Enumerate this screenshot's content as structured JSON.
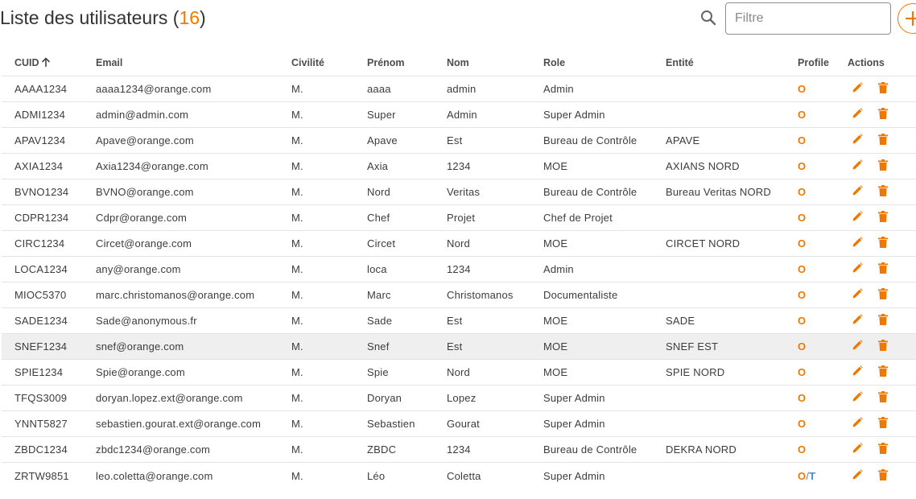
{
  "header": {
    "title": "Liste des utilisateurs",
    "count_open": "(",
    "count": "16",
    "count_close": ")",
    "filter_placeholder": "Filtre",
    "filter_value": ""
  },
  "table": {
    "columns": [
      "CUID",
      "Email",
      "Civilité",
      "Prénom",
      "Nom",
      "Role",
      "Entité",
      "Profile",
      "Actions"
    ],
    "sorted_column": "CUID",
    "sort_direction": "ascending",
    "rows": [
      {
        "cuid": "AAAA1234",
        "email": "aaaa1234@orange.com",
        "civilite": "M.",
        "prenom": "aaaa",
        "nom": "admin",
        "role": "Admin",
        "entite": "",
        "profile": [
          "O"
        ]
      },
      {
        "cuid": "ADMI1234",
        "email": "admin@admin.com",
        "civilite": "M.",
        "prenom": "Super",
        "nom": "Admin",
        "role": "Super Admin",
        "entite": "",
        "profile": [
          "O"
        ]
      },
      {
        "cuid": "APAV1234",
        "email": "Apave@orange.com",
        "civilite": "M.",
        "prenom": "Apave",
        "nom": "Est",
        "role": "Bureau de Contrôle",
        "entite": "APAVE",
        "profile": [
          "O"
        ]
      },
      {
        "cuid": "AXIA1234",
        "email": "Axia1234@orange.com",
        "civilite": "M.",
        "prenom": "Axia",
        "nom": "1234",
        "role": "MOE",
        "entite": "AXIANS NORD",
        "profile": [
          "O"
        ]
      },
      {
        "cuid": "BVNO1234",
        "email": "BVNO@orange.com",
        "civilite": "M.",
        "prenom": "Nord",
        "nom": "Veritas",
        "role": "Bureau de Contrôle",
        "entite": "Bureau Veritas NORD",
        "profile": [
          "O"
        ]
      },
      {
        "cuid": "CDPR1234",
        "email": "Cdpr@orange.com",
        "civilite": "M.",
        "prenom": "Chef",
        "nom": "Projet",
        "role": "Chef de Projet",
        "entite": "",
        "profile": [
          "O"
        ]
      },
      {
        "cuid": "CIRC1234",
        "email": "Circet@orange.com",
        "civilite": "M.",
        "prenom": "Circet",
        "nom": "Nord",
        "role": "MOE",
        "entite": "CIRCET NORD",
        "profile": [
          "O"
        ]
      },
      {
        "cuid": "LOCA1234",
        "email": "any@orange.com",
        "civilite": "M.",
        "prenom": "loca",
        "nom": "1234",
        "role": "Admin",
        "entite": "",
        "profile": [
          "O"
        ]
      },
      {
        "cuid": "MIOC5370",
        "email": "marc.christomanos@orange.com",
        "civilite": "M.",
        "prenom": "Marc",
        "nom": "Christomanos",
        "role": "Documentaliste",
        "entite": "",
        "profile": [
          "O"
        ]
      },
      {
        "cuid": "SADE1234",
        "email": "Sade@anonymous.fr",
        "civilite": "M.",
        "prenom": "Sade",
        "nom": "Est",
        "role": "MOE",
        "entite": "SADE",
        "profile": [
          "O"
        ]
      },
      {
        "cuid": "SNEF1234",
        "email": "snef@orange.com",
        "civilite": "M.",
        "prenom": "Snef",
        "nom": "Est",
        "role": "MOE",
        "entite": "SNEF EST",
        "profile": [
          "O"
        ],
        "highlighted": true
      },
      {
        "cuid": "SPIE1234",
        "email": "Spie@orange.com",
        "civilite": "M.",
        "prenom": "Spie",
        "nom": "Nord",
        "role": "MOE",
        "entite": "SPIE NORD",
        "profile": [
          "O"
        ]
      },
      {
        "cuid": "TFQS3009",
        "email": "doryan.lopez.ext@orange.com",
        "civilite": "M.",
        "prenom": "Doryan",
        "nom": "Lopez",
        "role": "Super Admin",
        "entite": "",
        "profile": [
          "O"
        ]
      },
      {
        "cuid": "YNNT5827",
        "email": "sebastien.gourat.ext@orange.com",
        "civilite": "M.",
        "prenom": "Sebastien",
        "nom": "Gourat",
        "role": "Super Admin",
        "entite": "",
        "profile": [
          "O"
        ]
      },
      {
        "cuid": "ZBDC1234",
        "email": "zbdc1234@orange.com",
        "civilite": "M.",
        "prenom": "ZBDC",
        "nom": "1234",
        "role": "Bureau de Contrôle",
        "entite": "DEKRA NORD",
        "profile": [
          "O"
        ]
      },
      {
        "cuid": "ZRTW9851",
        "email": "leo.coletta@orange.com",
        "civilite": "M.",
        "prenom": "Léo",
        "nom": "Coletta",
        "role": "Super Admin",
        "entite": "",
        "profile": [
          "O",
          "T"
        ]
      }
    ]
  },
  "icons": {
    "search": "search-icon",
    "add": "plus-icon",
    "sort": "arrow-up-icon",
    "edit": "pencil-icon",
    "delete": "trash-icon"
  },
  "colors": {
    "accent": "#f07800",
    "profile_secondary": "#3b8fd6",
    "row_highlight": "#efefef",
    "divider": "#e3e3e3"
  }
}
